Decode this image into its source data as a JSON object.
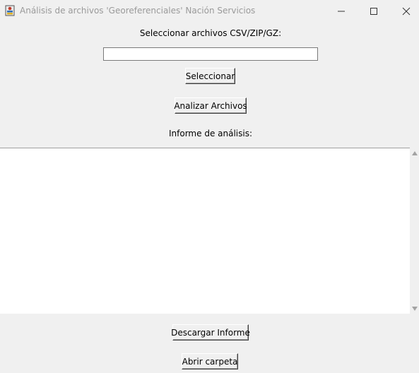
{
  "window": {
    "title": "Análisis de archivos 'Georeferenciales' Nación Servicios",
    "icon": "app-icon"
  },
  "form": {
    "select_label": "Seleccionar archivos CSV/ZIP/GZ:",
    "path_value": "",
    "select_button": "Seleccionar",
    "analyze_button": "Analizar Archivos",
    "report_label": "Informe de análisis:",
    "report_text": "",
    "download_button": "Descargar Informe",
    "open_folder_button": "Abrir carpeta"
  }
}
